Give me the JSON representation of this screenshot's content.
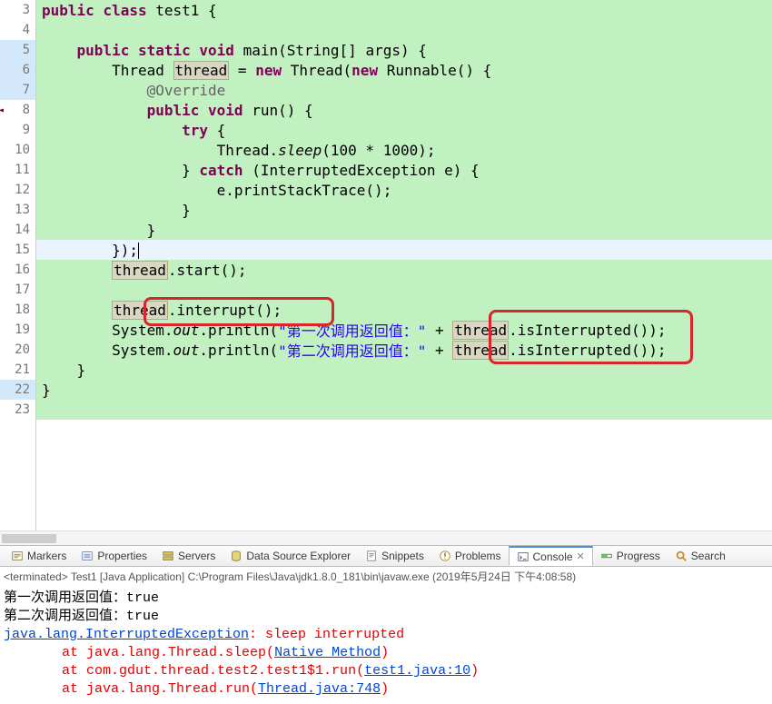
{
  "code": {
    "lines": [
      {
        "n": 3,
        "hl": false,
        "segments": [
          {
            "t": "public ",
            "c": "kw"
          },
          {
            "t": "class ",
            "c": "kw"
          },
          {
            "t": "test1 {",
            "c": ""
          }
        ]
      },
      {
        "n": 4,
        "hl": false,
        "segments": []
      },
      {
        "n": 5,
        "hl": true,
        "segments": [
          {
            "t": "    ",
            "c": ""
          },
          {
            "t": "public ",
            "c": "kw"
          },
          {
            "t": "static ",
            "c": "kw"
          },
          {
            "t": "void ",
            "c": "kw"
          },
          {
            "t": "main(String[] ",
            "c": ""
          },
          {
            "t": "args",
            "c": "typ"
          },
          {
            "t": ") {",
            "c": ""
          }
        ]
      },
      {
        "n": 6,
        "hl": true,
        "segments": [
          {
            "t": "        Thread ",
            "c": ""
          },
          {
            "t": "thread",
            "c": "var-hl"
          },
          {
            "t": " = ",
            "c": ""
          },
          {
            "t": "new ",
            "c": "kw"
          },
          {
            "t": "Thread(",
            "c": ""
          },
          {
            "t": "new ",
            "c": "kw"
          },
          {
            "t": "Runnable() {",
            "c": ""
          }
        ]
      },
      {
        "n": 7,
        "hl": true,
        "segments": [
          {
            "t": "            ",
            "c": ""
          },
          {
            "t": "@Override",
            "c": "ann"
          }
        ]
      },
      {
        "n": 8,
        "hl": false,
        "segments": [
          {
            "t": "            ",
            "c": ""
          },
          {
            "t": "public ",
            "c": "kw"
          },
          {
            "t": "void ",
            "c": "kw"
          },
          {
            "t": "run() {",
            "c": ""
          }
        ]
      },
      {
        "n": 9,
        "hl": false,
        "segments": [
          {
            "t": "                ",
            "c": ""
          },
          {
            "t": "try ",
            "c": "kw"
          },
          {
            "t": "{",
            "c": ""
          }
        ]
      },
      {
        "n": 10,
        "hl": false,
        "segments": [
          {
            "t": "                    Thread.",
            "c": ""
          },
          {
            "t": "sleep",
            "c": "stat"
          },
          {
            "t": "(100 * 1000);",
            "c": ""
          }
        ]
      },
      {
        "n": 11,
        "hl": false,
        "segments": [
          {
            "t": "                } ",
            "c": ""
          },
          {
            "t": "catch ",
            "c": "kw"
          },
          {
            "t": "(InterruptedException ",
            "c": ""
          },
          {
            "t": "e",
            "c": "typ"
          },
          {
            "t": ") {",
            "c": ""
          }
        ]
      },
      {
        "n": 12,
        "hl": false,
        "segments": [
          {
            "t": "                    ",
            "c": ""
          },
          {
            "t": "e",
            "c": "typ"
          },
          {
            "t": ".printStackTrace();",
            "c": ""
          }
        ]
      },
      {
        "n": 13,
        "hl": false,
        "segments": [
          {
            "t": "                }",
            "c": ""
          }
        ]
      },
      {
        "n": 14,
        "hl": false,
        "segments": [
          {
            "t": "            }",
            "c": ""
          }
        ]
      },
      {
        "n": 15,
        "hl": false,
        "lhl": true,
        "segments": [
          {
            "t": "        });",
            "c": ""
          }
        ],
        "cursor": true
      },
      {
        "n": 16,
        "hl": false,
        "segments": [
          {
            "t": "        ",
            "c": ""
          },
          {
            "t": "thread",
            "c": "var-hl"
          },
          {
            "t": ".start();",
            "c": ""
          }
        ]
      },
      {
        "n": 17,
        "hl": false,
        "segments": []
      },
      {
        "n": 18,
        "hl": false,
        "segments": [
          {
            "t": "        ",
            "c": ""
          },
          {
            "t": "thread",
            "c": "var-hl"
          },
          {
            "t": ".interrupt();",
            "c": ""
          }
        ]
      },
      {
        "n": 19,
        "hl": false,
        "segments": [
          {
            "t": "        System.",
            "c": ""
          },
          {
            "t": "out",
            "c": "stat"
          },
          {
            "t": ".println(",
            "c": ""
          },
          {
            "t": "\"第一次调用返回值：\"",
            "c": "str"
          },
          {
            "t": " + ",
            "c": ""
          },
          {
            "t": "thread",
            "c": "var-hl"
          },
          {
            "t": ".isInterrupted());",
            "c": ""
          }
        ]
      },
      {
        "n": 20,
        "hl": false,
        "segments": [
          {
            "t": "        System.",
            "c": ""
          },
          {
            "t": "out",
            "c": "stat"
          },
          {
            "t": ".println(",
            "c": ""
          },
          {
            "t": "\"第二次调用返回值：\"",
            "c": "str"
          },
          {
            "t": " + ",
            "c": ""
          },
          {
            "t": "thread",
            "c": "var-hl"
          },
          {
            "t": ".isInterrupted());",
            "c": ""
          }
        ]
      },
      {
        "n": 21,
        "hl": false,
        "segments": [
          {
            "t": "    }",
            "c": ""
          }
        ]
      },
      {
        "n": 22,
        "hl": true,
        "segments": [
          {
            "t": "}",
            "c": ""
          }
        ]
      },
      {
        "n": 23,
        "hl": false,
        "segments": []
      }
    ]
  },
  "tabs": [
    {
      "id": "markers",
      "label": "Markers"
    },
    {
      "id": "properties",
      "label": "Properties"
    },
    {
      "id": "servers",
      "label": "Servers"
    },
    {
      "id": "datasource",
      "label": "Data Source Explorer"
    },
    {
      "id": "snippets",
      "label": "Snippets"
    },
    {
      "id": "problems",
      "label": "Problems"
    },
    {
      "id": "console",
      "label": "Console",
      "active": true,
      "closable": true
    },
    {
      "id": "progress",
      "label": "Progress"
    },
    {
      "id": "search",
      "label": "Search"
    }
  ],
  "console": {
    "header": "<terminated> Test1 [Java Application] C:\\Program Files\\Java\\jdk1.8.0_181\\bin\\javaw.exe (2019年5月24日 下午4:08:58)",
    "out1": "第一次调用返回值：true",
    "out2": "第二次调用返回值：true",
    "exc": "java.lang.InterruptedException",
    "excmsg": ": sleep interrupted",
    "at": "at ",
    "tr1a": "java.lang.Thread.sleep(",
    "tr1b": "Native Method",
    "tr1c": ")",
    "tr2a": "com.gdut.thread.test2.test1$1.run(",
    "tr2b": "test1.java:10",
    "tr2c": ")",
    "tr3a": "java.lang.Thread.run(",
    "tr3b": "Thread.java:748",
    "tr3c": ")"
  }
}
